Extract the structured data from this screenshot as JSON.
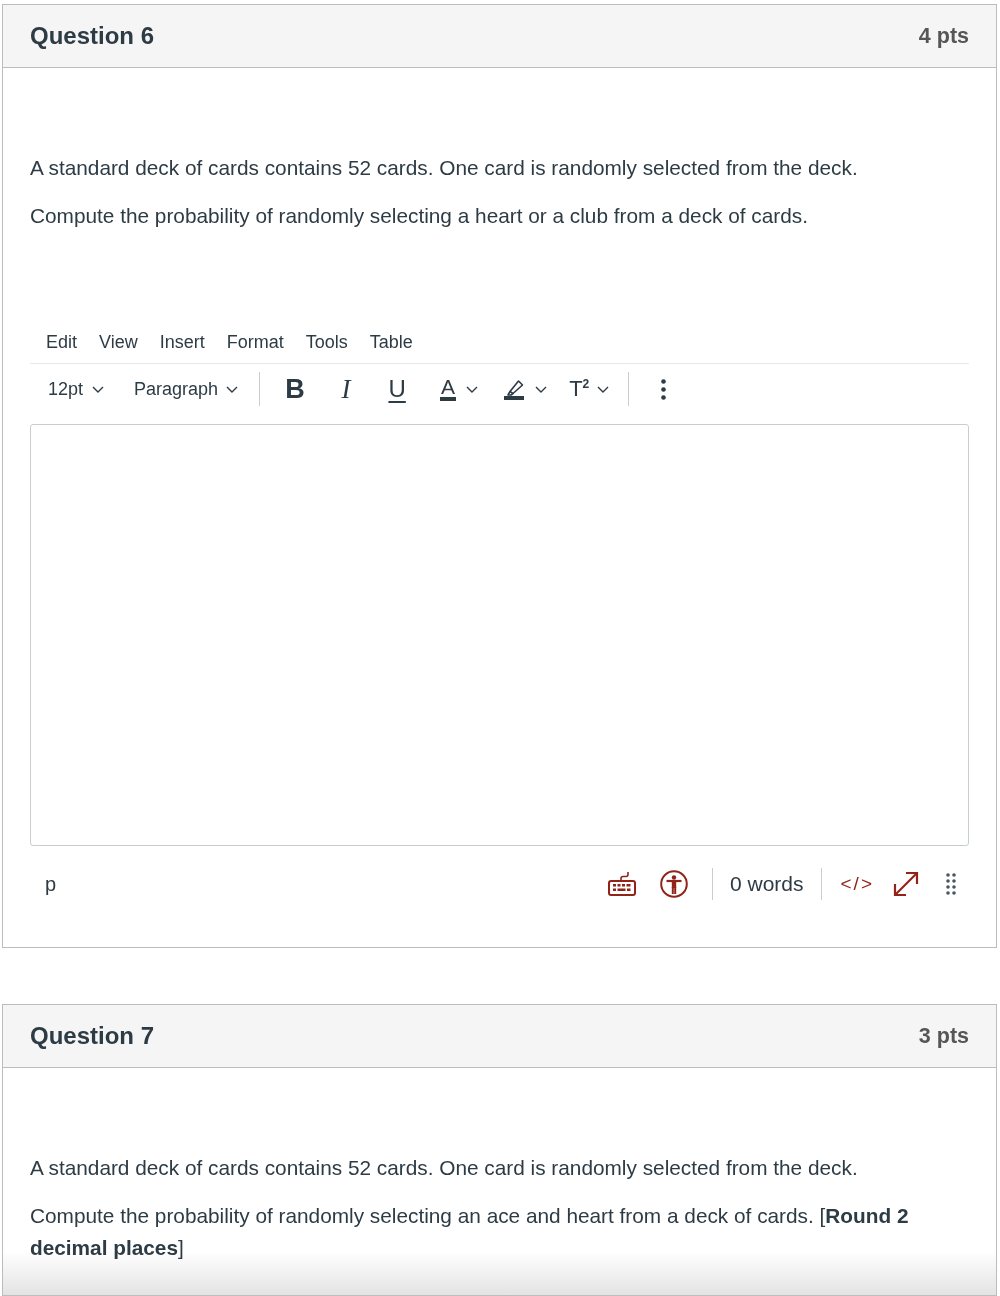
{
  "questions": [
    {
      "title": "Question 6",
      "points": "4 pts",
      "paragraphs": [
        "A standard deck of cards contains 52 cards. One card is randomly selected from the deck.",
        "Compute the probability of randomly selecting a heart or a club from a deck of cards."
      ],
      "editor": {
        "menu": [
          "Edit",
          "View",
          "Insert",
          "Format",
          "Tools",
          "Table"
        ],
        "toolbar": [
          {
            "kind": "font-size",
            "label": "12pt"
          },
          {
            "kind": "block-format",
            "label": "Paragraph"
          },
          {
            "kind": "separator"
          },
          {
            "kind": "bold",
            "label": "B"
          },
          {
            "kind": "italic",
            "label": "I"
          },
          {
            "kind": "underline",
            "label": "U"
          },
          {
            "kind": "text-color",
            "label": "A"
          },
          {
            "kind": "highlight"
          },
          {
            "kind": "superscript",
            "label": "T$^{2}$"
          },
          {
            "kind": "separator"
          },
          {
            "kind": "more"
          }
        ],
        "status_bar": {
          "element_path": "p",
          "items": [
            {
              "kind": "keyboard"
            },
            {
              "kind": "accessibility"
            },
            {
              "kind": "separator"
            },
            {
              "kind": "word-count",
              "label": "0 words"
            },
            {
              "kind": "separator"
            },
            {
              "kind": "html-editor",
              "label": "</>"
            },
            {
              "kind": "fullscreen"
            },
            {
              "kind": "resize"
            }
          ]
        }
      }
    },
    {
      "title": "Question 7",
      "points": "3 pts",
      "paragraphs": [
        "A standard deck of cards contains 52 cards. One card is randomly selected from the deck.",
        "Compute the probability of randomly selecting an ace and heart from a deck of cards. [**Round 2 decimal places**]"
      ]
    }
  ]
}
